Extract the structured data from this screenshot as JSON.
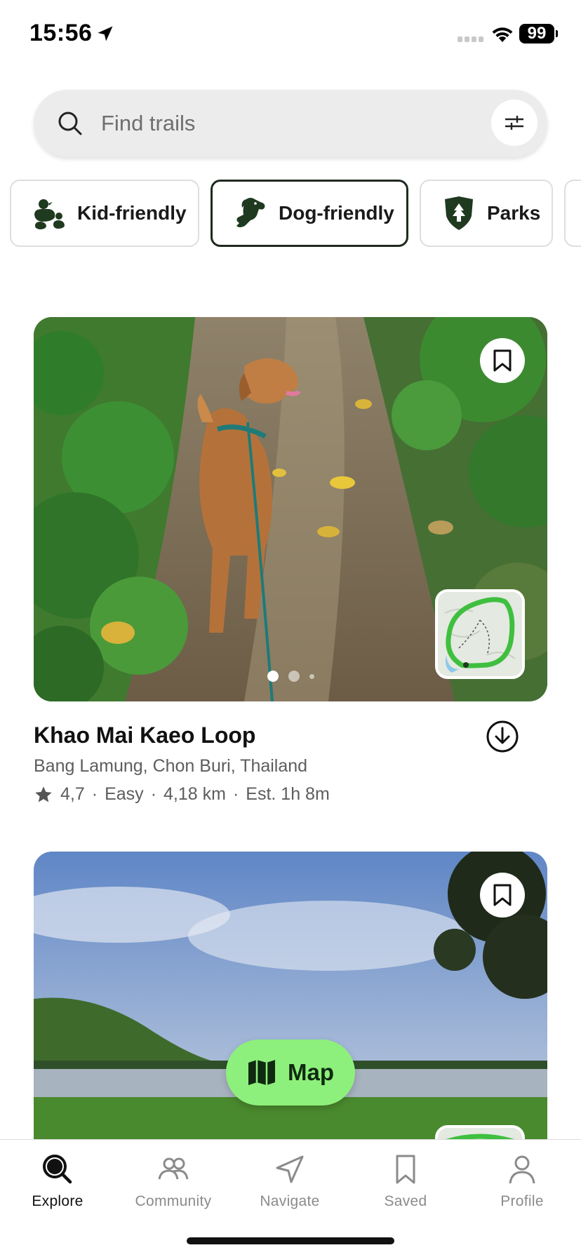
{
  "status_bar": {
    "time": "15:56",
    "battery": "99",
    "icons": [
      "location-arrow-icon",
      "cellular-signal-icon",
      "wifi-icon",
      "battery-icon"
    ]
  },
  "search": {
    "placeholder": "Find trails",
    "icons": [
      "search-icon",
      "filter-sliders-icon"
    ]
  },
  "chips": [
    {
      "label": "Kid-friendly",
      "icon": "duck-family-icon",
      "selected": false
    },
    {
      "label": "Dog-friendly",
      "icon": "dog-icon",
      "selected": true
    },
    {
      "label": "Parks",
      "icon": "park-badge-icon",
      "selected": false
    }
  ],
  "cards": [
    {
      "title": "Khao Mai Kaeo Loop",
      "location": "Bang Lamung, Chon Buri, Thailand",
      "rating": "4,7",
      "difficulty": "Easy",
      "distance": "4,18 km",
      "duration": "Est. 1h 8m",
      "separator": "·",
      "photo_count": 3,
      "active_photo": 0
    },
    {
      "title": "",
      "location": ""
    }
  ],
  "map_button": {
    "label": "Map",
    "icon": "map-icon"
  },
  "tab_bar": {
    "items": [
      {
        "label": "Explore",
        "icon": "search-icon",
        "active": true
      },
      {
        "label": "Community",
        "icon": "people-icon",
        "active": false
      },
      {
        "label": "Navigate",
        "icon": "navigate-arrow-icon",
        "active": false
      },
      {
        "label": "Saved",
        "icon": "bookmark-icon",
        "active": false
      },
      {
        "label": "Profile",
        "icon": "person-icon",
        "active": false
      }
    ]
  },
  "colors": {
    "accent_green": "#8ef07c",
    "dark_green": "#1f3a1f",
    "trail_green": "#3fbf3f"
  }
}
